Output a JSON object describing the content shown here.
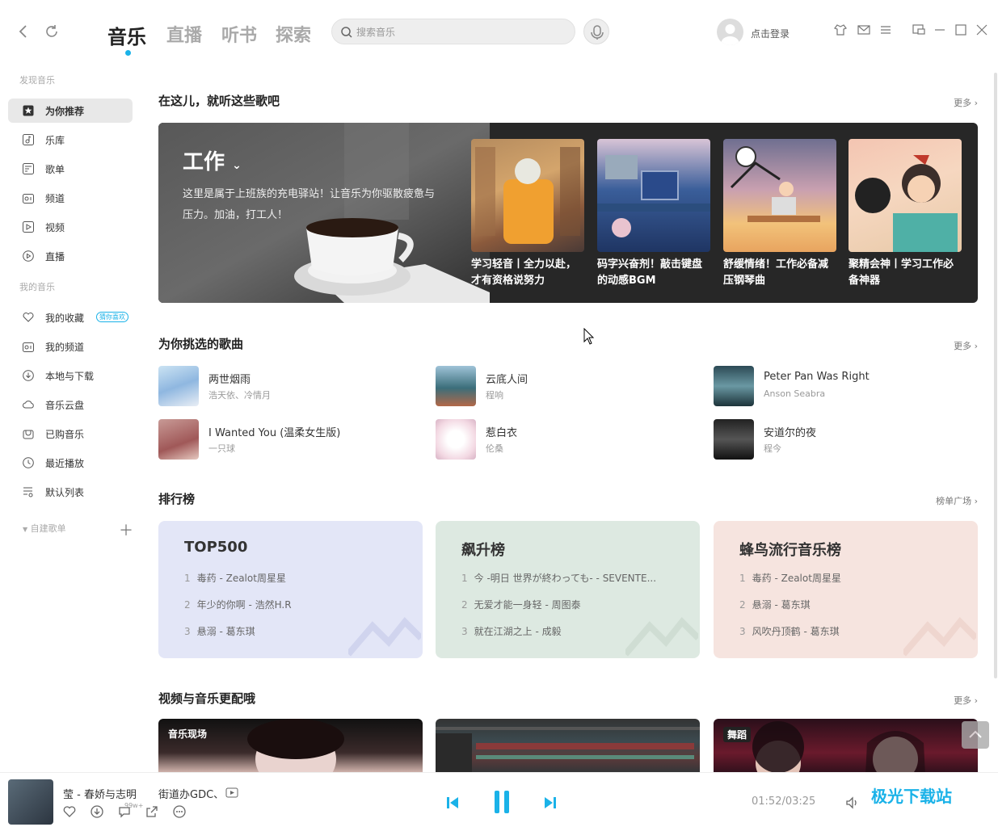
{
  "topbar": {
    "tabs": [
      {
        "label": "音乐"
      },
      {
        "label": "直播"
      },
      {
        "label": "听书"
      },
      {
        "label": "探索"
      }
    ],
    "search_placeholder": "搜索音乐",
    "login_label": "点击登录"
  },
  "sidebar": {
    "group1": "发现音乐",
    "items1": [
      {
        "label": "为你推荐"
      },
      {
        "label": "乐库"
      },
      {
        "label": "歌单"
      },
      {
        "label": "频道"
      },
      {
        "label": "视频"
      },
      {
        "label": "直播"
      }
    ],
    "group2": "我的音乐",
    "items2": [
      {
        "label": "我的收藏",
        "badge": "猜你喜欢"
      },
      {
        "label": "我的频道"
      },
      {
        "label": "本地与下载"
      },
      {
        "label": "音乐云盘"
      },
      {
        "label": "已购音乐"
      },
      {
        "label": "最近播放"
      },
      {
        "label": "默认列表"
      }
    ],
    "group3": "自建歌单"
  },
  "section1": {
    "title": "在这儿，就听这些歌吧",
    "more": "更多",
    "banner_title": "工作",
    "banner_desc": "这里是属于上班族的充电驿站！让音乐为你驱散疲惫与压力。加油，打工人！",
    "playlists": [
      {
        "title": "学习轻音丨全力以赴，才有资格说努力"
      },
      {
        "title": "码字兴奋剂！敲击键盘的动感BGM"
      },
      {
        "title": "舒缓情绪！工作必备减压钢琴曲"
      },
      {
        "title": "聚精会神丨学习工作必备神器"
      }
    ]
  },
  "section2": {
    "title": "为你挑选的歌曲",
    "more": "更多",
    "songs": [
      {
        "name": "两世烟雨",
        "artist": "浩天依、冷情月"
      },
      {
        "name": "云底人间",
        "artist": "程响"
      },
      {
        "name": "Peter Pan Was Right",
        "artist": "Anson Seabra"
      },
      {
        "name": "I Wanted You (温柔女生版)",
        "artist": "一只球"
      },
      {
        "name": "惹白衣",
        "artist": "伦桑"
      },
      {
        "name": "安道尔的夜",
        "artist": "程今"
      }
    ]
  },
  "section3": {
    "title": "排行榜",
    "more": "榜单广场",
    "charts": [
      {
        "title": "TOP500",
        "items": [
          {
            "n": "1",
            "t": "毒药 - Zealot周星星"
          },
          {
            "n": "2",
            "t": "年少的你啊 - 浩然H.R"
          },
          {
            "n": "3",
            "t": "悬溺 - 葛东琪"
          }
        ]
      },
      {
        "title": "飙升榜",
        "items": [
          {
            "n": "1",
            "t": "今 -明日 世界が終わっても- - SEVENTE..."
          },
          {
            "n": "2",
            "t": "无爱才能一身轻 - 周图泰"
          },
          {
            "n": "3",
            "t": "就在江湖之上 - 成毅"
          }
        ]
      },
      {
        "title": "蜂鸟流行音乐榜",
        "items": [
          {
            "n": "1",
            "t": "毒药 - Zealot周星星"
          },
          {
            "n": "2",
            "t": "悬溺 - 葛东琪"
          },
          {
            "n": "3",
            "t": "风吹丹顶鹤 - 葛东琪"
          }
        ]
      }
    ]
  },
  "section4": {
    "title": "视频与音乐更配哦",
    "more": "更多",
    "videos": [
      {
        "tag": "音乐现场"
      },
      {
        "tag": ""
      },
      {
        "tag": "舞蹈"
      }
    ]
  },
  "player": {
    "title": "莹 - 春娇与志明",
    "extra": "街道办GDC、",
    "count": "99w+",
    "time": "01:52/03:25",
    "progress": 0.554
  },
  "watermark": "极光下载站",
  "colors": {
    "accent": "#1ab2e8",
    "rank1": "#e3e6f7",
    "rank2": "#dde9e1",
    "rank3": "#f6e4df"
  }
}
